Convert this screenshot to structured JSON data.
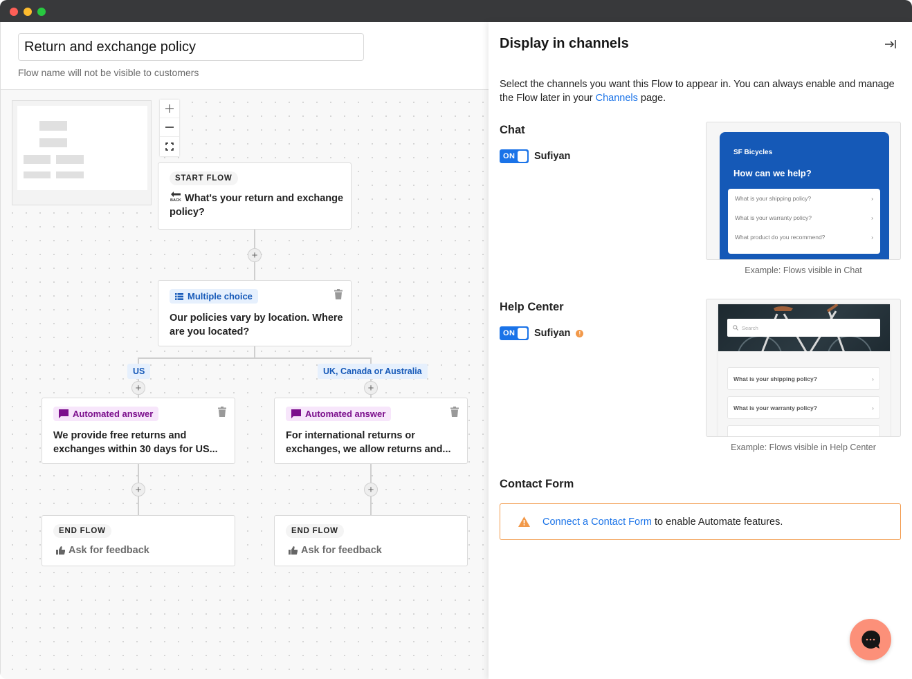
{
  "window": {
    "controls": [
      "close",
      "minimize",
      "maximize"
    ]
  },
  "editor": {
    "flow_name_value": "Return and exchange policy",
    "flow_name_hint": "Flow name will not be visible to customers",
    "zoom_controls": {
      "zoom_in": "+",
      "zoom_out": "−",
      "fit": "fit-screen-icon"
    },
    "start_node": {
      "tag": "START FLOW",
      "icon": "back-arrow-icon",
      "text": "What's your return and exchange policy?"
    },
    "choice_node": {
      "badge": "Multiple choice",
      "badge_icon": "list-icon",
      "text": "Our policies vary by location. Where are you located?"
    },
    "branches": [
      {
        "label": "US",
        "answer": {
          "badge": "Automated answer",
          "badge_icon": "message-icon",
          "text": "We provide free returns and exchanges within 30 days for US..."
        },
        "end": {
          "tag": "END FLOW",
          "text": "Ask for feedback",
          "icon": "thumbs-up-icon"
        }
      },
      {
        "label": "UK, Canada or Australia",
        "answer": {
          "badge": "Automated answer",
          "badge_icon": "message-icon",
          "text": "For international returns or exchanges, we allow returns and..."
        },
        "end": {
          "tag": "END FLOW",
          "text": "Ask for feedback",
          "icon": "thumbs-up-icon"
        }
      }
    ]
  },
  "panel": {
    "title": "Display in channels",
    "collapse_icon": "collapse-right-icon",
    "description_pre": "Select the channels you want this Flow to appear in. You can always enable and manage the Flow later in your ",
    "description_link": "Channels",
    "description_post": " page.",
    "chat": {
      "title": "Chat",
      "toggle_state": "ON",
      "toggle_name": "Sufiyan",
      "preview": {
        "brand": "SF Bicycles",
        "headline": "How can we help?",
        "items": [
          "What is your shipping policy?",
          "What is your warranty policy?",
          "What product do you recommend?"
        ]
      },
      "caption": "Example: Flows visible in Chat"
    },
    "help_center": {
      "title": "Help Center",
      "toggle_state": "ON",
      "toggle_name": "Sufiyan",
      "warning_icon": "!",
      "preview": {
        "search_placeholder": "Search",
        "items": [
          "What is your shipping policy?",
          "What is your warranty policy?"
        ]
      },
      "caption": "Example: Flows visible in Help Center"
    },
    "contact_form": {
      "title": "Contact Form",
      "alert_link": "Connect a Contact Form",
      "alert_text": " to enable Automate features."
    }
  },
  "colors": {
    "accent_blue": "#1a73e8",
    "warning_orange": "#f2994a",
    "chat_widget_blue": "#1559b7",
    "fab_coral": "#fc9079"
  }
}
